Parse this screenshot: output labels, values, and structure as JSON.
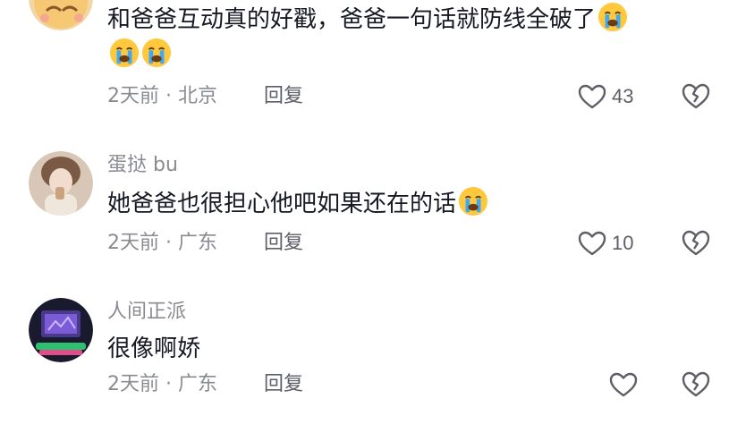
{
  "comments": [
    {
      "username": "",
      "text": "和爸爸互动真的好戳，爸爸一句话就防线全破了",
      "emojis": [
        "loudly-crying-face",
        "loudly-crying-face",
        "loudly-crying-face"
      ],
      "time": "2天前",
      "location": "北京",
      "reply_label": "回复",
      "like_count": "43"
    },
    {
      "username": "蛋挞 bu",
      "text": "她爸爸也很担心他吧如果还在的话",
      "emojis": [
        "loudly-crying-face"
      ],
      "time": "2天前",
      "location": "广东",
      "reply_label": "回复",
      "like_count": "10"
    },
    {
      "username": "人间正派",
      "text": "很像啊娇",
      "emojis": [],
      "time": "2天前",
      "location": "广东",
      "reply_label": "回复",
      "like_count": ""
    }
  ],
  "meta_separator": "·",
  "colors": {
    "text": "#161823",
    "secondary": "#8a8b91",
    "action": "#5e5f66",
    "emoji_face": "#ffc83d",
    "emoji_tear": "#3fa9f5"
  }
}
